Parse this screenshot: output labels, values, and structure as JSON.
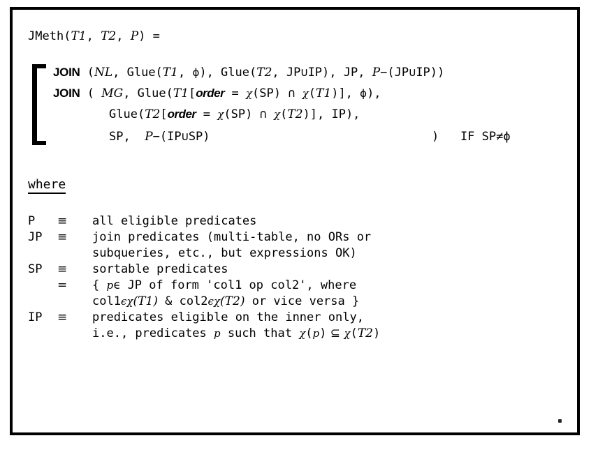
{
  "figure": {
    "kind": "formal-definition-figure",
    "border_color": "#000000",
    "background_color": "#ffffff",
    "text_color": "#000000"
  },
  "equation": {
    "head": {
      "name": "JMeth",
      "open": "(",
      "arg1": "T1",
      "comma1": ", ",
      "arg2": "T2",
      "comma2": ", ",
      "arg3": "P",
      "close": ")",
      "equals": " ="
    },
    "alternatives": [
      {
        "keyword": "JOIN",
        "method": "NL",
        "parts": [
          " (",
          "NL",
          ", Glue(",
          "T1",
          ", ",
          "ϕ",
          "), Glue(",
          "T2",
          ", JP∪IP), JP, ",
          "P",
          "−(JP∪IP))"
        ]
      },
      {
        "keyword": "JOIN",
        "method": "MG",
        "line1_parts": [
          " ( ",
          "MG",
          ", Glue(",
          "T1",
          "[",
          "order",
          " = ",
          "χ",
          "(SP) ∩ ",
          "χ",
          "(",
          "T1",
          ")], ",
          "ϕ",
          "),"
        ],
        "line2_parts": [
          "Glue(",
          "T2",
          "[",
          "order",
          " = ",
          "χ",
          "(SP) ∩ ",
          "χ",
          "(",
          "T2",
          ")], IP),"
        ],
        "line3_parts": [
          "SP,  ",
          "P",
          "−(IP∪SP)"
        ],
        "condition": ")   IF SP≠ϕ"
      }
    ]
  },
  "where": {
    "heading": "where",
    "definitions": [
      {
        "symbol": "P",
        "relation": "≡",
        "lines": [
          "all eligible predicates"
        ]
      },
      {
        "symbol": "JP",
        "relation": "≡",
        "lines": [
          "join predicates (multi-table, no ORs or",
          "subqueries, etc., but expressions OK)"
        ]
      },
      {
        "symbol": "SP",
        "relation": "≡",
        "lines": [
          "sortable predicates"
        ]
      },
      {
        "symbol": "",
        "relation": "=",
        "lines_rich": true,
        "line1": {
          "pre": "{ ",
          "var": "p",
          "mid": "ϵ JP of form 'col1 op col2', where"
        },
        "line2": {
          "a": "col1",
          "chi1": "ϵχ",
          "t1": "(T1)",
          "amp": " & ",
          "b": "col2",
          "chi2": "ϵχ",
          "t2": "(T2)",
          "tail": " or vice versa }"
        }
      },
      {
        "symbol": "IP",
        "relation": "≡",
        "lines_rich": true,
        "line1_plain": "predicates eligible on the inner only,",
        "line2": {
          "pre": "i.e., predicates ",
          "var": "p",
          "mid": " such that ",
          "chi1": "χ",
          "arg1": "(",
          "var2": "p",
          "arg1c": ")",
          "subset": " ⊆ ",
          "chi2": "χ",
          "arg2": "(",
          "t2": "T2",
          "arg2c": ")"
        }
      }
    ]
  }
}
